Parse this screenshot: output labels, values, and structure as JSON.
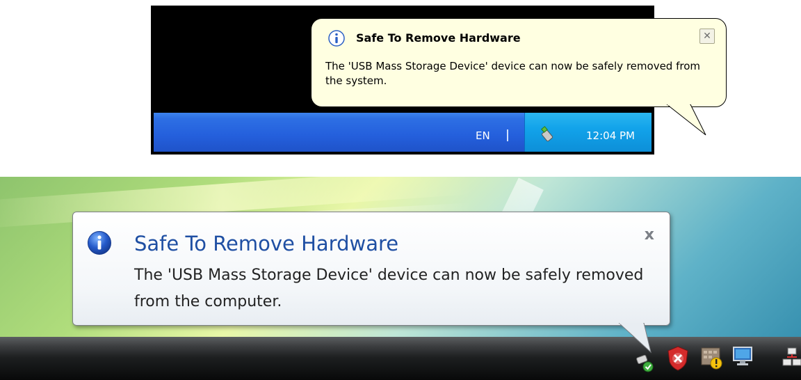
{
  "xp": {
    "balloon": {
      "title": "Safe To Remove Hardware",
      "message": "The 'USB Mass Storage Device' device can now be safely removed from the system.",
      "close_glyph": "✕",
      "info_icon": "info-icon"
    },
    "taskbar": {
      "language": "EN",
      "clock": "12:04 PM",
      "tray_icon": "usb-device-icon"
    }
  },
  "vista": {
    "balloon": {
      "title": "Safe To Remove Hardware",
      "message": "The 'USB Mass Storage Device' device can now be safely removed from the computer.",
      "close_glyph": "x",
      "info_icon": "info-icon"
    },
    "taskbar": {
      "tray_icons": [
        "usb-device-icon",
        "security-alert-icon",
        "warning-calendar-icon",
        "monitor-icon",
        "network-icon"
      ]
    }
  },
  "colors": {
    "xp_balloon": "#ffffe1",
    "xp_taskbar": "#245fdc",
    "xp_tray": "#12a3ea",
    "vista_title": "#1f4fa3"
  }
}
